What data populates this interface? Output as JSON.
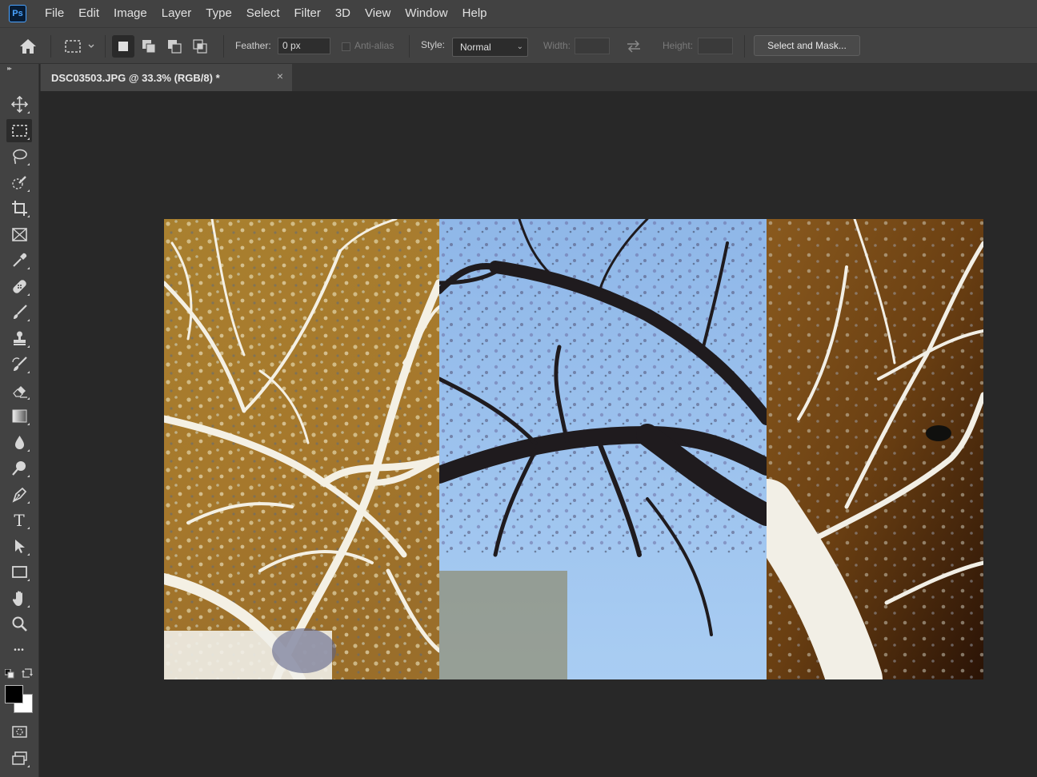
{
  "app": {
    "logo_text": "Ps"
  },
  "menu": [
    "File",
    "Edit",
    "Image",
    "Layer",
    "Type",
    "Select",
    "Filter",
    "3D",
    "View",
    "Window",
    "Help"
  ],
  "options_bar": {
    "feather_label": "Feather:",
    "feather_value": "0 px",
    "anti_alias_label": "Anti-alias",
    "style_label": "Style:",
    "style_value": "Normal",
    "width_label": "Width:",
    "height_label": "Height:",
    "select_mask_label": "Select and Mask..."
  },
  "document": {
    "tab_title": "DSC03503.JPG @ 33.3% (RGB/8) *",
    "close_glyph": "×"
  },
  "toolbar": {
    "tools": [
      "move",
      "rectangular-marquee",
      "lasso",
      "quick-selection",
      "crop",
      "frame",
      "eyedropper",
      "spot-healing-brush",
      "brush",
      "clone-stamp",
      "history-brush",
      "eraser",
      "gradient",
      "blur",
      "dodge",
      "pen",
      "type",
      "path-selection",
      "rectangle",
      "hand",
      "zoom",
      "edit-toolbar"
    ],
    "active_tool": "rectangular-marquee",
    "type_tool_glyph": "T",
    "more_glyph": "•••",
    "foreground_color": "#000000",
    "background_color": "#ffffff"
  },
  "image_colors": {
    "left_panel_bg": "#a67a30",
    "center_sky": "#9ec3ee",
    "right_panel_dark": "#3a1e08",
    "right_panel_light": "#8a5a1e",
    "inverted_branch": "#f4f0e6",
    "dark_branch": "#1e1a1c"
  }
}
